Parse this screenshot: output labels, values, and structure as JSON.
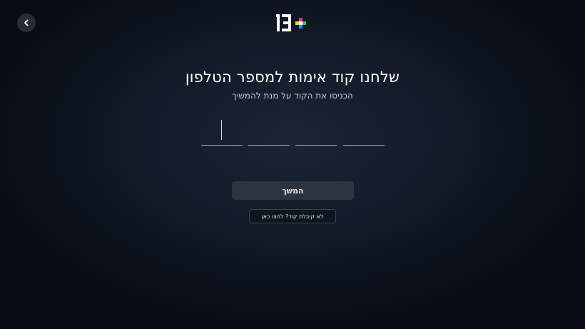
{
  "header": {
    "back_icon": "chevron-left-icon",
    "logo_text": "13+",
    "logo_colors": {
      "pink": "#ff2d8a",
      "yellow": "#ffd400",
      "green": "#22d16a",
      "blue": "#2f8bff"
    }
  },
  "verify": {
    "title": "שלחנו קוד אימות למספר הטלפון",
    "subtitle": "הכניסו את הקוד על מנת להמשיך",
    "code_digits": [
      "",
      "",
      "",
      ""
    ],
    "continue_label": "המשך",
    "resend_label": "לא קיבלת קוד? לחצו כאן"
  }
}
